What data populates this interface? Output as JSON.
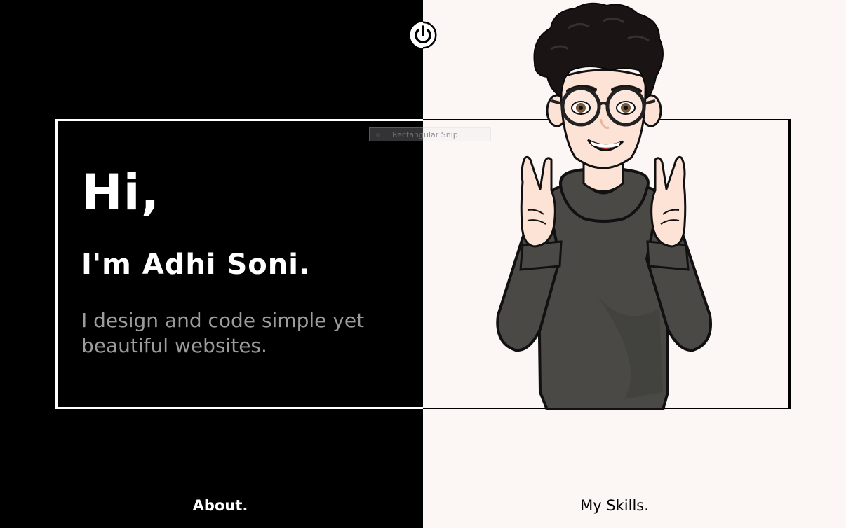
{
  "hero": {
    "greeting": "Hi,",
    "name": "I'm Adhi Soni.",
    "tagline": "I design and code simple yet beautiful websites."
  },
  "overlay": {
    "snip_label": "Rectangular Snip"
  },
  "nav": {
    "about_label": "About.",
    "skills_label": "My Skills."
  },
  "icons": {
    "theme_toggle": "power-icon",
    "snip_mode": "dot-icon"
  },
  "colors": {
    "left_bg": "#000000",
    "right_bg": "#fcf6f4",
    "primary_text_dark_bg": "#ffffff",
    "secondary_text": "#9c9c9c",
    "hoodie": "#4a4946",
    "skin": "#fde3d6",
    "hair": "#1a1414"
  }
}
